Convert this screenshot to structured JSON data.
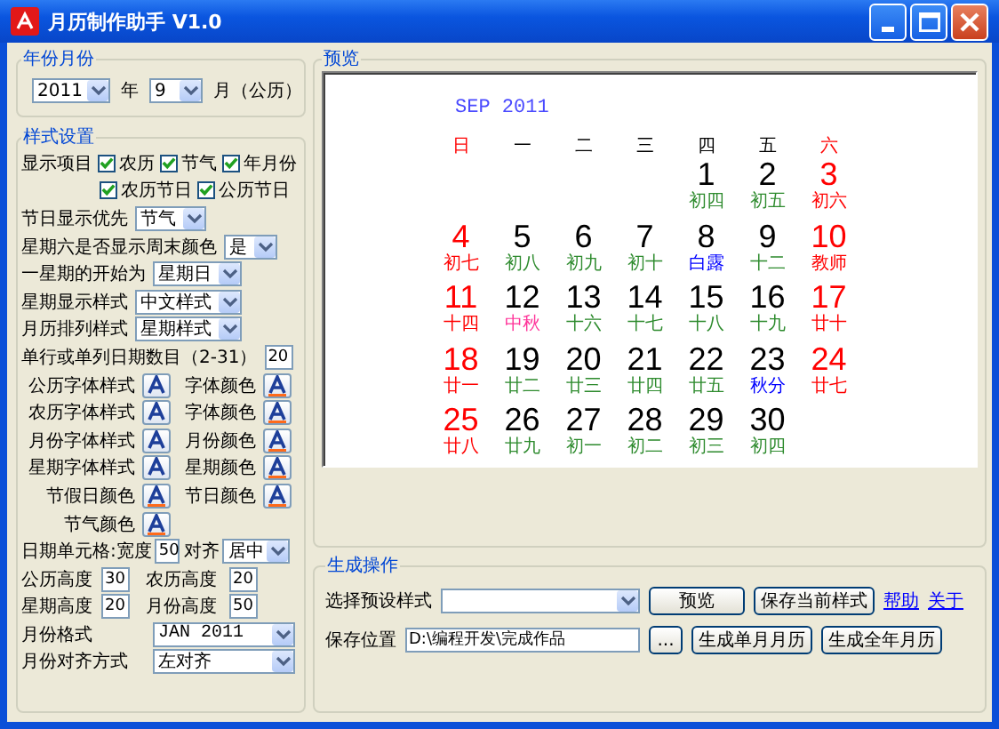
{
  "window": {
    "title": "月历制作助手 V1.0"
  },
  "year_month": {
    "title": "年份月份",
    "year": "2011",
    "year_label": "年",
    "month": "9",
    "month_label": "月（公历）"
  },
  "style_settings": {
    "title": "样式设置",
    "rows": [
      {
        "kind": "checks",
        "label": "显示项目",
        "items": [
          {
            "label": "农历",
            "checked": true
          },
          {
            "label": "节气",
            "checked": true
          },
          {
            "label": "年月份",
            "checked": true
          }
        ]
      },
      {
        "kind": "checks",
        "items": [
          {
            "label": "农历节日",
            "checked": true
          },
          {
            "label": "公历节日",
            "checked": true
          }
        ]
      },
      {
        "kind": "select",
        "label": "节日显示优先",
        "value": "节气"
      },
      {
        "kind": "select",
        "label": "星期六是否显示周末颜色",
        "value": "是"
      },
      {
        "kind": "select",
        "label": "一星期的开始为",
        "value": "星期日"
      },
      {
        "kind": "select",
        "label": "星期显示样式",
        "value": "中文样式"
      },
      {
        "kind": "select",
        "label": "月历排列样式",
        "value": "星期样式"
      },
      {
        "kind": "input",
        "label": "单行或单列日期数目（2-31）",
        "value": "20"
      },
      {
        "kind": "buttons",
        "items": [
          {
            "label": "公历字体样式",
            "kind": "font"
          },
          {
            "label": "字体颜色",
            "kind": "color"
          }
        ]
      },
      {
        "kind": "buttons",
        "items": [
          {
            "label": "农历字体样式",
            "kind": "font"
          },
          {
            "label": "字体颜色",
            "kind": "color"
          }
        ]
      },
      {
        "kind": "buttons",
        "items": [
          {
            "label": "月份字体样式",
            "kind": "font"
          },
          {
            "label": "月份颜色",
            "kind": "color"
          }
        ]
      },
      {
        "kind": "buttons",
        "items": [
          {
            "label": "星期字体样式",
            "kind": "font"
          },
          {
            "label": "星期颜色",
            "kind": "color"
          }
        ]
      },
      {
        "kind": "buttons",
        "items": [
          {
            "label": "节假日颜色",
            "kind": "color"
          },
          {
            "label": "节日颜色",
            "kind": "color"
          }
        ]
      },
      {
        "kind": "buttons",
        "items": [
          {
            "label": "节气颜色",
            "kind": "color"
          }
        ]
      },
      {
        "kind": "cell",
        "label": "日期单元格:宽度",
        "value": "50",
        "align_label": "对齐",
        "align": "居中"
      },
      {
        "kind": "inputs",
        "items": [
          {
            "label": "公历高度",
            "value": "30"
          },
          {
            "label": "农历高度",
            "value": "20"
          }
        ]
      },
      {
        "kind": "inputs",
        "items": [
          {
            "label": "星期高度",
            "value": "20"
          },
          {
            "label": "月份高度",
            "value": "50"
          }
        ]
      },
      {
        "kind": "wide_select",
        "label": "月份格式",
        "value": "JAN 2011"
      },
      {
        "kind": "wide_select",
        "label": "月份对齐方式",
        "value": "左对齐"
      }
    ]
  },
  "preview": {
    "title": "预览",
    "month": "SEP 2011",
    "weekdays": [
      {
        "label": "日",
        "color": "#ff0000"
      },
      {
        "label": "一",
        "color": "#000000"
      },
      {
        "label": "二",
        "color": "#000000"
      },
      {
        "label": "三",
        "color": "#000000"
      },
      {
        "label": "四",
        "color": "#000000"
      },
      {
        "label": "五",
        "color": "#000000"
      },
      {
        "label": "六",
        "color": "#ff0000"
      }
    ],
    "weeks": [
      [
        {
          "kind": "blank"
        },
        {
          "kind": "blank"
        },
        {
          "kind": "blank"
        },
        {
          "kind": "blank"
        },
        {
          "kind": "day",
          "day": "1",
          "color": "#000000",
          "lunar": {
            "text": "初四",
            "color": "#2e8b2e"
          }
        },
        {
          "kind": "day",
          "day": "2",
          "color": "#000000",
          "lunar": {
            "text": "初五",
            "color": "#2e8b2e"
          }
        },
        {
          "kind": "day",
          "day": "3",
          "color": "#ff0000",
          "lunar": {
            "text": "初六",
            "color": "#ff0000"
          }
        }
      ],
      [
        {
          "kind": "day",
          "day": "4",
          "color": "#ff0000",
          "lunar": {
            "text": "初七",
            "color": "#ff0000"
          }
        },
        {
          "kind": "day",
          "day": "5",
          "color": "#000000",
          "lunar": {
            "text": "初八",
            "color": "#2e8b2e"
          }
        },
        {
          "kind": "day",
          "day": "6",
          "color": "#000000",
          "lunar": {
            "text": "初九",
            "color": "#2e8b2e"
          }
        },
        {
          "kind": "day",
          "day": "7",
          "color": "#000000",
          "lunar": {
            "text": "初十",
            "color": "#2e8b2e"
          }
        },
        {
          "kind": "day",
          "day": "8",
          "color": "#000000",
          "lunar": {
            "text": "白露",
            "color": "#0000ff"
          }
        },
        {
          "kind": "day",
          "day": "9",
          "color": "#000000",
          "lunar": {
            "text": "十二",
            "color": "#2e8b2e"
          }
        },
        {
          "kind": "day",
          "day": "10",
          "color": "#ff0000",
          "lunar": {
            "text": "教师",
            "color": "#ff0000"
          }
        }
      ],
      [
        {
          "kind": "day",
          "day": "11",
          "color": "#ff0000",
          "lunar": {
            "text": "十四",
            "color": "#ff0000"
          }
        },
        {
          "kind": "day",
          "day": "12",
          "color": "#000000",
          "lunar": {
            "text": "中秋",
            "color": "#ff3399"
          }
        },
        {
          "kind": "day",
          "day": "13",
          "color": "#000000",
          "lunar": {
            "text": "十六",
            "color": "#2e8b2e"
          }
        },
        {
          "kind": "day",
          "day": "14",
          "color": "#000000",
          "lunar": {
            "text": "十七",
            "color": "#2e8b2e"
          }
        },
        {
          "kind": "day",
          "day": "15",
          "color": "#000000",
          "lunar": {
            "text": "十八",
            "color": "#2e8b2e"
          }
        },
        {
          "kind": "day",
          "day": "16",
          "color": "#000000",
          "lunar": {
            "text": "十九",
            "color": "#2e8b2e"
          }
        },
        {
          "kind": "day",
          "day": "17",
          "color": "#ff0000",
          "lunar": {
            "text": "廿十",
            "color": "#ff0000"
          }
        }
      ],
      [
        {
          "kind": "day",
          "day": "18",
          "color": "#ff0000",
          "lunar": {
            "text": "廿一",
            "color": "#ff0000"
          }
        },
        {
          "kind": "day",
          "day": "19",
          "color": "#000000",
          "lunar": {
            "text": "廿二",
            "color": "#2e8b2e"
          }
        },
        {
          "kind": "day",
          "day": "20",
          "color": "#000000",
          "lunar": {
            "text": "廿三",
            "color": "#2e8b2e"
          }
        },
        {
          "kind": "day",
          "day": "21",
          "color": "#000000",
          "lunar": {
            "text": "廿四",
            "color": "#2e8b2e"
          }
        },
        {
          "kind": "day",
          "day": "22",
          "color": "#000000",
          "lunar": {
            "text": "廿五",
            "color": "#2e8b2e"
          }
        },
        {
          "kind": "day",
          "day": "23",
          "color": "#000000",
          "lunar": {
            "text": "秋分",
            "color": "#0000ff"
          }
        },
        {
          "kind": "day",
          "day": "24",
          "color": "#ff0000",
          "lunar": {
            "text": "廿七",
            "color": "#ff0000"
          }
        }
      ],
      [
        {
          "kind": "day",
          "day": "25",
          "color": "#ff0000",
          "lunar": {
            "text": "廿八",
            "color": "#ff0000"
          }
        },
        {
          "kind": "day",
          "day": "26",
          "color": "#000000",
          "lunar": {
            "text": "廿九",
            "color": "#2e8b2e"
          }
        },
        {
          "kind": "day",
          "day": "27",
          "color": "#000000",
          "lunar": {
            "text": "初一",
            "color": "#2e8b2e"
          }
        },
        {
          "kind": "day",
          "day": "28",
          "color": "#000000",
          "lunar": {
            "text": "初二",
            "color": "#2e8b2e"
          }
        },
        {
          "kind": "day",
          "day": "29",
          "color": "#000000",
          "lunar": {
            "text": "初三",
            "color": "#2e8b2e"
          }
        },
        {
          "kind": "day",
          "day": "30",
          "color": "#000000",
          "lunar": {
            "text": "初四",
            "color": "#2e8b2e"
          }
        },
        {
          "kind": "blank"
        }
      ]
    ]
  },
  "actions": {
    "title": "生成操作",
    "preset_label": "选择预设样式",
    "preview_button": "预览",
    "save_style_button": "保存当前样式",
    "help_link": "帮助",
    "about_link": "关于",
    "save_label": "保存位置",
    "save_path": "D:\\编程开发\\完成作品",
    "browse_button": "...",
    "month_button": "生成单月月历",
    "year_button": "生成全年月历"
  }
}
